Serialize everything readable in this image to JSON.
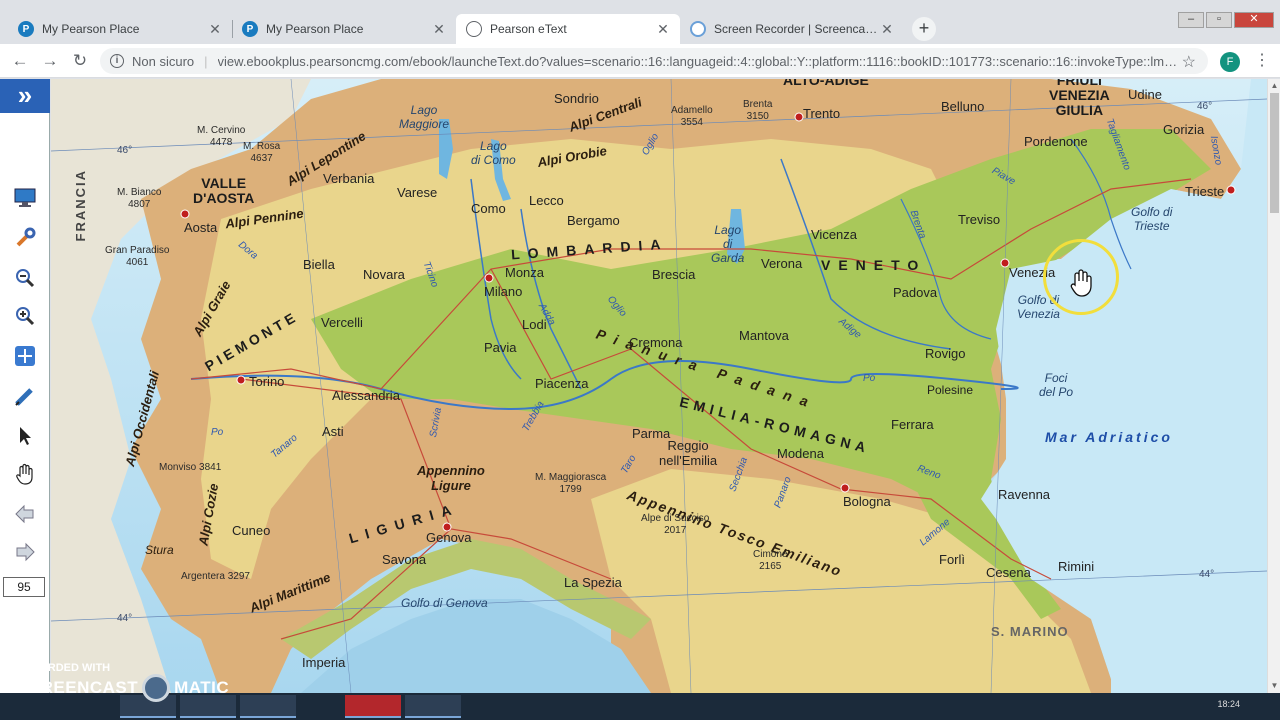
{
  "browser": {
    "tabs": [
      {
        "title": "My Pearson Place",
        "favicon": "pearson-p-icon",
        "active": false
      },
      {
        "title": "My Pearson Place",
        "favicon": "pearson-p-icon",
        "active": false
      },
      {
        "title": "Pearson eText",
        "favicon": "globe-icon",
        "active": true
      },
      {
        "title": "Screen Recorder | Screencast-O-M",
        "favicon": "screencast-icon",
        "active": false
      }
    ],
    "new_tab": "+",
    "security_label": "Non sicuro",
    "url": "view.ebookplus.pearsoncmg.com/ebook/launcheText.do?values=scenario::16::languageid::4::global::Y::platform::1116::bookID::101773::scenario::16::invokeType::lms::l...",
    "profile_initial": "F",
    "colors": {
      "accent": "#2a62b6",
      "profile": "#12937f",
      "tab_strip": "#dee1e6"
    }
  },
  "sidebar": {
    "expand_label": "»",
    "tools": [
      "monitor-icon",
      "wrench-icon",
      "zoom-out-icon",
      "zoom-in-icon",
      "fit-page-icon",
      "highlighter-pen-icon",
      "pointer-arrow-icon",
      "pan-hand-icon",
      "previous-page-icon",
      "next-page-icon"
    ],
    "page_number": "95"
  },
  "map": {
    "regions": [
      {
        "id": "valle",
        "text": "VALLE\nD'AOSTA"
      },
      {
        "id": "piemonte",
        "text": "PIEMONTE"
      },
      {
        "id": "lombardia",
        "text": "LOMBARDIA"
      },
      {
        "id": "veneto",
        "text": "VENETO"
      },
      {
        "id": "friuli",
        "text": "FRIULI\nVENEZIA\nGIULIA"
      },
      {
        "id": "trentino",
        "text": "ALTO-ADIGE"
      },
      {
        "id": "emilia",
        "text": "EMILIA-ROMAGNA"
      },
      {
        "id": "liguria",
        "text": "LIGURIA"
      },
      {
        "id": "sanmarino",
        "text": "S. MARINO"
      },
      {
        "id": "francia",
        "text": "FRANCIA"
      }
    ],
    "cities": [
      {
        "id": "aosta",
        "text": "Aosta"
      },
      {
        "id": "biella",
        "text": "Biella"
      },
      {
        "id": "novara",
        "text": "Novara"
      },
      {
        "id": "vercelli",
        "text": "Vercelli"
      },
      {
        "id": "torino",
        "text": "Torino"
      },
      {
        "id": "alessandria",
        "text": "Alessandria"
      },
      {
        "id": "asti",
        "text": "Asti"
      },
      {
        "id": "cuneo",
        "text": "Cuneo"
      },
      {
        "id": "verbania",
        "text": "Verbania"
      },
      {
        "id": "varese",
        "text": "Varese"
      },
      {
        "id": "como",
        "text": "Como"
      },
      {
        "id": "lecco",
        "text": "Lecco"
      },
      {
        "id": "sondrio",
        "text": "Sondrio"
      },
      {
        "id": "bergamo",
        "text": "Bergamo"
      },
      {
        "id": "monza",
        "text": "Monza"
      },
      {
        "id": "milano",
        "text": "Milano"
      },
      {
        "id": "lodi",
        "text": "Lodi"
      },
      {
        "id": "pavia",
        "text": "Pavia"
      },
      {
        "id": "brescia",
        "text": "Brescia"
      },
      {
        "id": "cremona",
        "text": "Cremona"
      },
      {
        "id": "mantova",
        "text": "Mantova"
      },
      {
        "id": "piacenza",
        "text": "Piacenza"
      },
      {
        "id": "parma",
        "text": "Parma"
      },
      {
        "id": "reggio",
        "text": "Reggio\nnell'Emilia"
      },
      {
        "id": "modena",
        "text": "Modena"
      },
      {
        "id": "bologna",
        "text": "Bologna"
      },
      {
        "id": "ferrara",
        "text": "Ferrara"
      },
      {
        "id": "ravenna",
        "text": "Ravenna"
      },
      {
        "id": "forli",
        "text": "Forlì"
      },
      {
        "id": "cesena",
        "text": "Cesena"
      },
      {
        "id": "rimini",
        "text": "Rimini"
      },
      {
        "id": "genova",
        "text": "Genova"
      },
      {
        "id": "savona",
        "text": "Savona"
      },
      {
        "id": "imperia",
        "text": "Imperia"
      },
      {
        "id": "laspezia",
        "text": "La Spezia"
      },
      {
        "id": "trento",
        "text": "Trento"
      },
      {
        "id": "verona",
        "text": "Verona"
      },
      {
        "id": "vicenza",
        "text": "Vicenza"
      },
      {
        "id": "padova",
        "text": "Padova"
      },
      {
        "id": "rovigo",
        "text": "Rovigo"
      },
      {
        "id": "treviso",
        "text": "Treviso"
      },
      {
        "id": "venezia",
        "text": "Venezia"
      },
      {
        "id": "belluno",
        "text": "Belluno"
      },
      {
        "id": "pordenone",
        "text": "Pordenone"
      },
      {
        "id": "udine",
        "text": "Udine"
      },
      {
        "id": "gorizia",
        "text": "Gorizia"
      },
      {
        "id": "trieste",
        "text": "Trieste"
      }
    ],
    "mountains": [
      {
        "id": "alpi_lepontine",
        "text": "Alpi Lepontine"
      },
      {
        "id": "alpi_pennine",
        "text": "Alpi Pennine"
      },
      {
        "id": "alpi_graie",
        "text": "Alpi Graie"
      },
      {
        "id": "alpi_occidentali",
        "text": "Alpi Occidentali"
      },
      {
        "id": "alpi_cozie",
        "text": "Alpi Cozie"
      },
      {
        "id": "alpi_marittime",
        "text": "Alpi Marittime"
      },
      {
        "id": "alpi_centrali",
        "text": "Alpi Centrali"
      },
      {
        "id": "alpi_orobie",
        "text": "Alpi Orobie"
      },
      {
        "id": "appennino_ligure",
        "text": "Appennino\nLigure"
      },
      {
        "id": "appennino_te",
        "text": "Appennino Tosco Emiliano"
      },
      {
        "id": "pianura_padana",
        "text": "Pianura Padana"
      },
      {
        "id": "stura",
        "text": "Stura"
      }
    ],
    "peaks": [
      {
        "id": "cervino",
        "text": "M. Cervino\n4478"
      },
      {
        "id": "rosa",
        "text": "M. Rosa\n4637"
      },
      {
        "id": "bianco",
        "text": "M. Bianco\n4807"
      },
      {
        "id": "paradiso",
        "text": "Gran Paradiso\n4061"
      },
      {
        "id": "monviso",
        "text": "Monviso 3841"
      },
      {
        "id": "argentera",
        "text": "Argentera 3297"
      },
      {
        "id": "adamello",
        "text": "Adamello\n3554"
      },
      {
        "id": "brenta",
        "text": "Brenta\n3150"
      },
      {
        "id": "maggiorasca",
        "text": "M. Maggiorasca\n1799"
      },
      {
        "id": "succiso",
        "text": "Alpe di Succiso\n2017"
      },
      {
        "id": "cimone",
        "text": "Cimone\n2165"
      }
    ],
    "waters": [
      {
        "id": "lago_maggiore",
        "text": "Lago\nMaggiore"
      },
      {
        "id": "lago_como",
        "text": "Lago\ndi Como"
      },
      {
        "id": "lago_garda",
        "text": "Lago\ndi\nGarda"
      },
      {
        "id": "golfo_venezia",
        "text": "Golfo di\nVenezia"
      },
      {
        "id": "golfo_trieste",
        "text": "Golfo di\nTrieste"
      },
      {
        "id": "foci_po",
        "text": "Foci\ndel Po"
      },
      {
        "id": "golfo_genova",
        "text": "Golfo di Genova"
      },
      {
        "id": "polesine",
        "text": "Polesine"
      }
    ],
    "rivers": [
      {
        "id": "ticino",
        "text": "Ticino"
      },
      {
        "id": "adda",
        "text": "Adda"
      },
      {
        "id": "oglio",
        "text": "Oglio"
      },
      {
        "id": "oglio2",
        "text": "Oglio"
      },
      {
        "id": "po1",
        "text": "Po"
      },
      {
        "id": "po2",
        "text": "Po"
      },
      {
        "id": "adige",
        "text": "Adige"
      },
      {
        "id": "brenta_r",
        "text": "Brenta"
      },
      {
        "id": "piave",
        "text": "Piave"
      },
      {
        "id": "tagliamento",
        "text": "Tagliamento"
      },
      {
        "id": "isonzo",
        "text": "Isonzo"
      },
      {
        "id": "dora",
        "text": "Dora"
      },
      {
        "id": "tanaro",
        "text": "Tanaro"
      },
      {
        "id": "scrivia",
        "text": "Scrivia"
      },
      {
        "id": "trebbia",
        "text": "Trebbia"
      },
      {
        "id": "taro",
        "text": "Taro"
      },
      {
        "id": "secchia",
        "text": "Secchia"
      },
      {
        "id": "panaro",
        "text": "Panaro"
      },
      {
        "id": "reno",
        "text": "Reno"
      },
      {
        "id": "lamone",
        "text": "Lamone"
      }
    ],
    "sea": "Mar Adriatico",
    "latitudes": [
      "46°",
      "46°",
      "44°",
      "44°"
    ]
  },
  "taskbar": {
    "clock": "18:24"
  },
  "watermark": {
    "line1": "RECORDED WITH",
    "line2a": "SCREENCAST",
    "line2b": "MATIC"
  }
}
